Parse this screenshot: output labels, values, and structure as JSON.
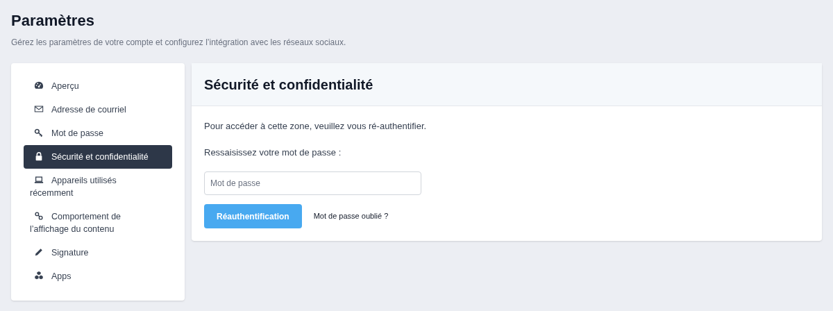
{
  "header": {
    "title": "Paramètres",
    "subtitle": "Gérez les paramètres de votre compte et configurez l’intégration avec les réseaux sociaux."
  },
  "sidebar": {
    "items": [
      {
        "label": "Aperçu",
        "selected": false
      },
      {
        "label": "Adresse de courriel",
        "selected": false
      },
      {
        "label": "Mot de passe",
        "selected": false
      },
      {
        "label": "Sécurité et confidentialité",
        "selected": true
      },
      {
        "label": "Appareils utilisés récemment",
        "selected": false
      },
      {
        "label": "Comportement de l’affichage du contenu",
        "selected": false
      },
      {
        "label": "Signature",
        "selected": false
      },
      {
        "label": "Apps",
        "selected": false
      }
    ]
  },
  "panel": {
    "title": "Sécurité et confidentialité",
    "message": "Pour accéder à cette zone, veuillez vous ré-authentifier.",
    "prompt": "Ressaisissez votre mot de passe :",
    "password_field": {
      "placeholder": "Mot de passe"
    },
    "submit_button": "Réauthentification",
    "forgot_link": "Mot de passe oublié ?"
  }
}
